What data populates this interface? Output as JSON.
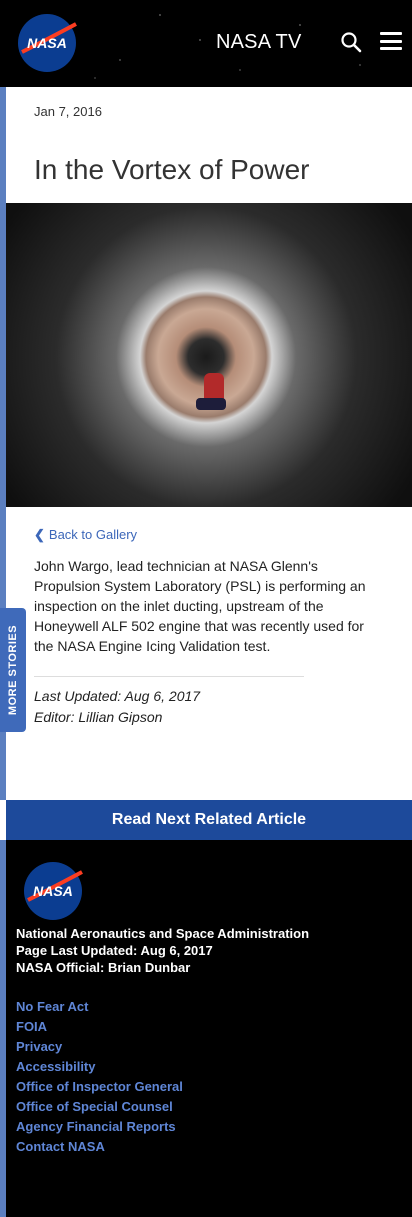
{
  "header": {
    "logo_text": "NASA",
    "nasa_tv_label": "NASA TV"
  },
  "sidebar_tab": {
    "label": "MORE STORIES"
  },
  "article": {
    "date": "Jan 7, 2016",
    "title": "In the Vortex of Power",
    "back_link": "Back to Gallery",
    "body": "John Wargo, lead technician at NASA Glenn's Propulsion System Laboratory (PSL) is performing an inspection on the inlet ducting, upstream of the Honeywell ALF 502 engine that was recently used for the NASA Engine Icing Validation test.",
    "last_updated": "Last Updated: Aug 6, 2017",
    "editor": "Editor: Lillian Gipson"
  },
  "read_next": {
    "label": "Read Next Related Article"
  },
  "footer": {
    "logo_text": "NASA",
    "agency_name": "National Aeronautics and Space Administration",
    "page_updated": "Page Last Updated: Aug 6, 2017",
    "official": "NASA Official: Brian Dunbar",
    "links": [
      "No Fear Act",
      "FOIA",
      "Privacy",
      "Accessibility",
      "Office of Inspector General",
      "Office of Special Counsel",
      "Agency Financial Reports",
      "Contact NASA"
    ]
  },
  "colors": {
    "nav_bg": "#000000",
    "accent_blue": "#1d4a9b",
    "link_blue": "#3c67b9",
    "sidebar_blue": "#5b7fc0"
  }
}
